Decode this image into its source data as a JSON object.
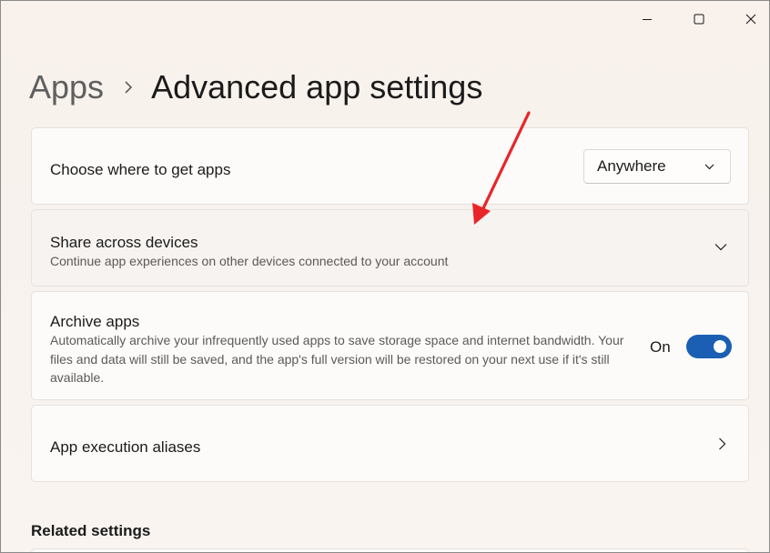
{
  "window": {
    "controls": {
      "minimize_icon": "minimize-icon",
      "maximize_icon": "maximize-icon",
      "close_icon": "close-icon"
    }
  },
  "breadcrumb": {
    "parent": "Apps",
    "separator_icon": "chevron-right-icon",
    "current": "Advanced app settings"
  },
  "settings": {
    "source": {
      "title": "Choose where to get apps",
      "dropdown_value": "Anywhere"
    },
    "share": {
      "title": "Share across devices",
      "description": "Continue app experiences on other devices connected to your account"
    },
    "archive": {
      "title": "Archive apps",
      "description": "Automatically archive your infrequently used apps to save storage space and internet bandwidth. Your files and data will still be saved, and the app's full version will be restored on your next use if it's still available.",
      "toggle_label": "On",
      "toggle_state": true
    },
    "aliases": {
      "title": "App execution aliases"
    }
  },
  "related": {
    "title": "Related settings"
  },
  "colors": {
    "accent": "#1a5fb4",
    "annotation_arrow": "#e8262a",
    "background": "#f9f3ef"
  }
}
